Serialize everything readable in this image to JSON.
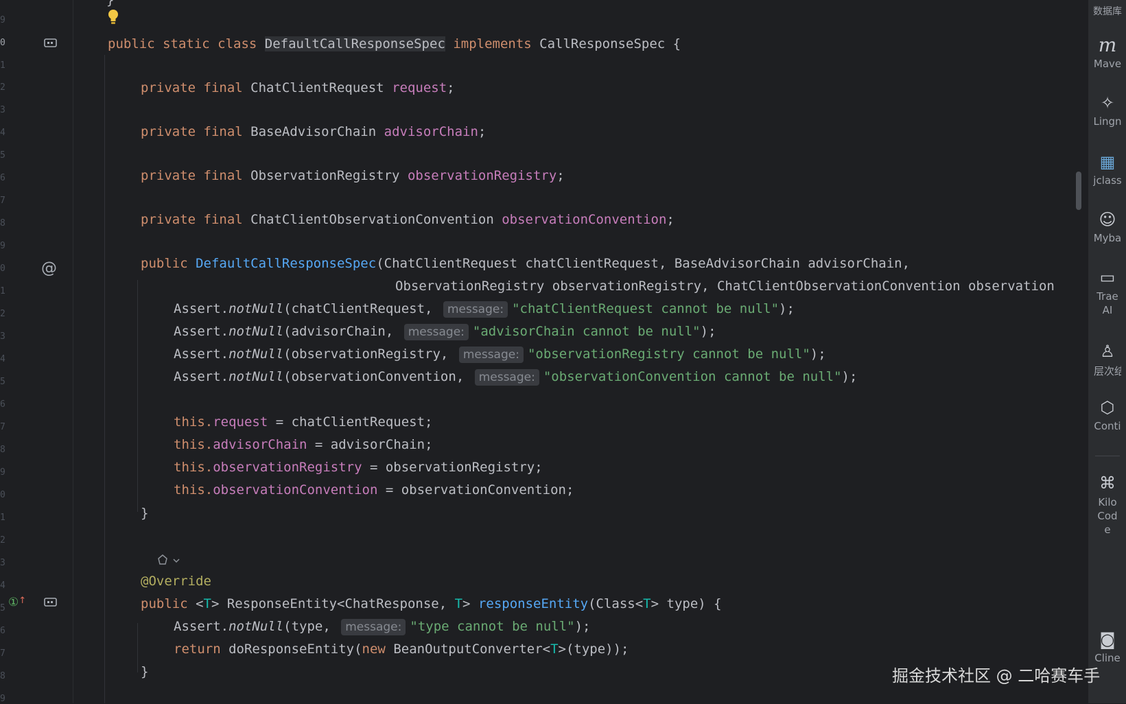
{
  "gutter": {
    "line_numbers": [
      "9",
      "0",
      "1",
      "2",
      "3",
      "4",
      "5",
      "6",
      "7",
      "8",
      "9",
      "0",
      "1",
      "2",
      "3",
      "4",
      "5",
      "6",
      "7",
      "8",
      "9",
      "0",
      "1",
      "2",
      "3",
      "4",
      "5",
      "6",
      "7",
      "8",
      "9"
    ],
    "at_symbol": "@",
    "override_marker": "①"
  },
  "code": {
    "l1": {
      "a": "public static class ",
      "b": "DefaultCallResponseSpec",
      "c": " implements ",
      "d": "CallResponseSpec {"
    },
    "l2": {
      "a": "private final ",
      "b": "ChatClientRequest ",
      "c": "request",
      ";": ";"
    },
    "l3": {
      "a": "private final ",
      "b": "BaseAdvisorChain ",
      "c": "advisorChain",
      ";": ";"
    },
    "l4": {
      "a": "private final ",
      "b": "ObservationRegistry ",
      "c": "observationRegistry",
      ";": ";"
    },
    "l5": {
      "a": "private final ",
      "b": "ChatClientObservationConvention ",
      "c": "observationConvention",
      ";": ";"
    },
    "l6": {
      "a": "public ",
      "b": "DefaultCallResponseSpec",
      "c": "(ChatClientRequest chatClientRequest, BaseAdvisorChain advisorChain,"
    },
    "l7": {
      "a": "ObservationRegistry observationRegistry, ChatClientObservationConvention observation"
    },
    "l8": {
      "a": "Assert.",
      "b": "notNull",
      "c": "(chatClientRequest, ",
      "h": "message:",
      "s": "\"chatClientRequest cannot be null\"",
      "e": ");"
    },
    "l9": {
      "a": "Assert.",
      "b": "notNull",
      "c": "(advisorChain, ",
      "h": "message:",
      "s": "\"advisorChain cannot be null\"",
      "e": ");"
    },
    "l10": {
      "a": "Assert.",
      "b": "notNull",
      "c": "(observationRegistry, ",
      "h": "message:",
      "s": "\"observationRegistry cannot be null\"",
      "e": ");"
    },
    "l11": {
      "a": "Assert.",
      "b": "notNull",
      "c": "(observationConvention, ",
      "h": "message:",
      "s": "\"observationConvention cannot be null\"",
      "e": ");"
    },
    "l12": {
      "a": "this.",
      "b": "request",
      "c": " = chatClientRequest;"
    },
    "l13": {
      "a": "this.",
      "b": "advisorChain",
      "c": " = advisorChain;"
    },
    "l14": {
      "a": "this.",
      "b": "observationRegistry",
      "c": " = observationRegistry;"
    },
    "l15": {
      "a": "this.",
      "b": "observationConvention",
      "c": " = observationConvention;"
    },
    "l16": {
      "a": "}"
    },
    "l17": {
      "a": "@Override"
    },
    "l18": {
      "a": "public ",
      "b": "<",
      "t1": "T",
      "c": "> ResponseEntity<ChatResponse, ",
      "t2": "T",
      "d": "> ",
      "f": "responseEntity",
      "g": "(Class<",
      "t3": "T",
      "h": "> type) {"
    },
    "l19": {
      "a": "Assert.",
      "b": "notNull",
      "c": "(type, ",
      "h": "message:",
      "s": "\"type cannot be null\"",
      "e": ");"
    },
    "l20": {
      "a": "return ",
      "b": "doResponseEntity(",
      "c": "new ",
      "d": "BeanOutputConverter<",
      "t": "T",
      "e": ">(type));"
    },
    "l21": {
      "a": "}"
    },
    "top_brace": "}"
  },
  "right_toolbar": {
    "items": [
      {
        "icon": "数据库",
        "label": "数据库"
      },
      {
        "icon": "m",
        "label": "Mave"
      },
      {
        "icon": "✧",
        "label": "Lingn"
      },
      {
        "icon": "▦",
        "label": "jclass"
      },
      {
        "icon": "☺",
        "label": "Myba"
      },
      {
        "icon": "▭",
        "label": "Trae AI"
      },
      {
        "icon": "♙",
        "label": "层次结"
      },
      {
        "icon": "⬡",
        "label": "Conti"
      },
      {
        "icon": "⌘",
        "label": "Kilo Code"
      },
      {
        "icon": "◙",
        "label": "Cline"
      }
    ]
  },
  "watermark": "掘金技术社区 @ 二哈赛车手"
}
